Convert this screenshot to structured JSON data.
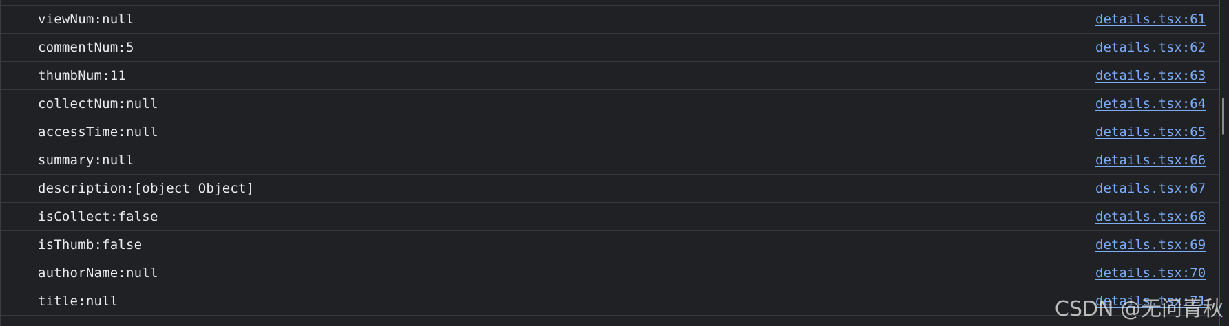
{
  "console": {
    "rows": [
      {
        "message": "viewNum:null",
        "source": "details.tsx:61"
      },
      {
        "message": "commentNum:5",
        "source": "details.tsx:62"
      },
      {
        "message": "thumbNum:11",
        "source": "details.tsx:63"
      },
      {
        "message": "collectNum:null",
        "source": "details.tsx:64"
      },
      {
        "message": "accessTime:null",
        "source": "details.tsx:65"
      },
      {
        "message": "summary:null",
        "source": "details.tsx:66"
      },
      {
        "message": "description:[object Object]",
        "source": "details.tsx:67"
      },
      {
        "message": "isCollect:false",
        "source": "details.tsx:68"
      },
      {
        "message": "isThumb:false",
        "source": "details.tsx:69"
      },
      {
        "message": "authorName:null",
        "source": "details.tsx:70"
      },
      {
        "message": "title:null",
        "source": "details.tsx:71"
      }
    ]
  },
  "watermark": "CSDN @无问青秋",
  "colors": {
    "background": "#202124",
    "text": "#e8eaed",
    "link": "#7cacf8",
    "divider": "#3a3a3d"
  }
}
